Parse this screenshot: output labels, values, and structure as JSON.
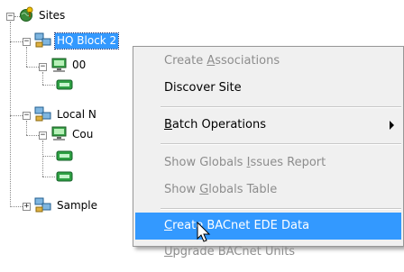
{
  "tree": {
    "root": {
      "label": "Sites",
      "expander": "−"
    },
    "nodes": [
      {
        "label": "HQ Block 2",
        "expander": "−",
        "selected": true
      },
      {
        "label": "00",
        "expander": "−"
      },
      {
        "label": "Local N",
        "expander": "−"
      },
      {
        "label": "Cou",
        "expander": "−"
      },
      {
        "label": "Sample",
        "expander": "+"
      }
    ]
  },
  "context_menu": {
    "items": [
      {
        "pre": "Create ",
        "key": "A",
        "post": "ssociations",
        "state": "disabled"
      },
      {
        "pre": "Discover Site",
        "key": "",
        "post": "",
        "state": "enabled"
      },
      {
        "pre": "",
        "key": "B",
        "post": "atch Operations",
        "state": "enabled",
        "submenu": true
      },
      {
        "pre": "Show Globals ",
        "key": "I",
        "post": "ssues Report",
        "state": "disabled"
      },
      {
        "pre": "Show ",
        "key": "G",
        "post": "lobals Table",
        "state": "disabled"
      },
      {
        "pre": "",
        "key": "C",
        "post": "reate BACnet EDE Data",
        "state": "highlighted"
      },
      {
        "pre": "",
        "key": "U",
        "post": "pgrade BACnet Units",
        "state": "disabled"
      }
    ]
  },
  "colors": {
    "selection": "#3399ff",
    "menu_background": "#f0f0f0",
    "disabled_text": "#8d8d8d"
  },
  "icons": {
    "sites": "globe-pin-icon",
    "site": "network-computers-icon",
    "device": "monitor-icon",
    "controller": "green-device-icon"
  }
}
